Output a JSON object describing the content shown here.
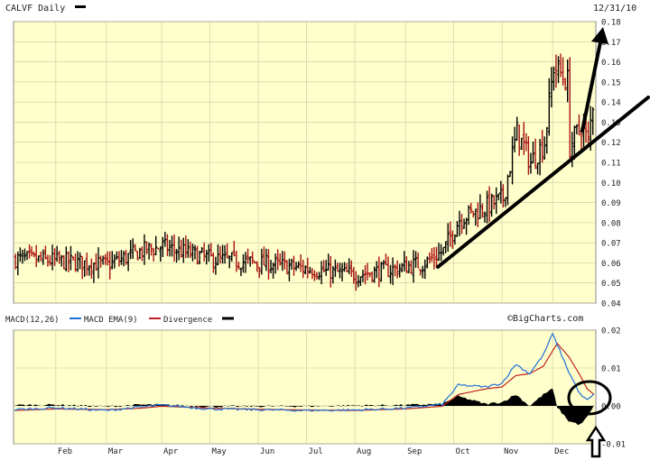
{
  "header": {
    "symbol_label": "CALVF Daily",
    "date_label": "12/31/10",
    "watermark": "©BigCharts.com"
  },
  "colors": {
    "plot_bg": "#ffffcc",
    "grid": "#c8c8a0",
    "up_bar": "#000000",
    "down_bar": "#aa1111",
    "macd_line": "#1f6fd8",
    "ema_line": "#c02020",
    "divergence": "#000000",
    "annotation": "#000000"
  },
  "chart_data": [
    {
      "type": "ohlc",
      "title": "CALVF Daily",
      "y_axis_side": "right",
      "ylim": [
        0.04,
        0.18
      ],
      "yticks": [
        "0.04",
        "0.05",
        "0.06",
        "0.07",
        "0.08",
        "0.09",
        "0.10",
        "0.11",
        "0.12",
        "0.13",
        "0.14",
        "0.15",
        "0.16",
        "0.17",
        "0.18"
      ],
      "months": [
        "Feb",
        "Mar",
        "Apr",
        "May",
        "Jun",
        "Jul",
        "Aug",
        "Sep",
        "Oct",
        "Nov",
        "Dec"
      ],
      "month_start_day": [
        18,
        40,
        64,
        85,
        106,
        127,
        148,
        170,
        191,
        212,
        234
      ],
      "total_days": 252,
      "price_anchors": [
        {
          "day": 0,
          "price": 0.062
        },
        {
          "day": 18,
          "price": 0.061
        },
        {
          "day": 40,
          "price": 0.059
        },
        {
          "day": 55,
          "price": 0.066
        },
        {
          "day": 64,
          "price": 0.068
        },
        {
          "day": 85,
          "price": 0.062
        },
        {
          "day": 106,
          "price": 0.06
        },
        {
          "day": 127,
          "price": 0.057
        },
        {
          "day": 148,
          "price": 0.054
        },
        {
          "day": 165,
          "price": 0.057
        },
        {
          "day": 178,
          "price": 0.06
        },
        {
          "day": 186,
          "price": 0.066
        },
        {
          "day": 193,
          "price": 0.082
        },
        {
          "day": 205,
          "price": 0.088
        },
        {
          "day": 212,
          "price": 0.092
        },
        {
          "day": 218,
          "price": 0.125
        },
        {
          "day": 224,
          "price": 0.11
        },
        {
          "day": 230,
          "price": 0.12
        },
        {
          "day": 234,
          "price": 0.158
        },
        {
          "day": 240,
          "price": 0.15
        },
        {
          "day": 241,
          "price": 0.118
        },
        {
          "day": 246,
          "price": 0.128
        },
        {
          "day": 249,
          "price": 0.12
        },
        {
          "day": 252,
          "price": 0.15
        }
      ]
    },
    {
      "type": "line",
      "title": "MACD(12,26)",
      "ylim": [
        -0.01,
        0.02
      ],
      "yticks": [
        "0.02",
        "0.01",
        "0.00",
        "-0.01"
      ],
      "series": [
        {
          "name": "MACD",
          "color": "#1f6fd8",
          "anchors": [
            {
              "day": 0,
              "value": -0.001
            },
            {
              "day": 18,
              "value": -0.0005
            },
            {
              "day": 40,
              "value": -0.0012
            },
            {
              "day": 55,
              "value": -0.0003
            },
            {
              "day": 64,
              "value": 0.0002
            },
            {
              "day": 85,
              "value": -0.0008
            },
            {
              "day": 106,
              "value": -0.001
            },
            {
              "day": 127,
              "value": -0.0012
            },
            {
              "day": 148,
              "value": -0.0011
            },
            {
              "day": 170,
              "value": -0.0006
            },
            {
              "day": 186,
              "value": 0.0004
            },
            {
              "day": 193,
              "value": 0.0055
            },
            {
              "day": 205,
              "value": 0.005
            },
            {
              "day": 212,
              "value": 0.006
            },
            {
              "day": 218,
              "value": 0.011
            },
            {
              "day": 224,
              "value": 0.0085
            },
            {
              "day": 230,
              "value": 0.0135
            },
            {
              "day": 234,
              "value": 0.019
            },
            {
              "day": 241,
              "value": 0.009
            },
            {
              "day": 246,
              "value": 0.003
            },
            {
              "day": 249,
              "value": 0.0015
            },
            {
              "day": 252,
              "value": 0.003
            }
          ]
        },
        {
          "name": "MACD EMA(9)",
          "color": "#c02020",
          "anchors": [
            {
              "day": 0,
              "value": -0.0012
            },
            {
              "day": 18,
              "value": -0.0008
            },
            {
              "day": 40,
              "value": -0.001
            },
            {
              "day": 55,
              "value": -0.0006
            },
            {
              "day": 64,
              "value": -0.0001
            },
            {
              "day": 85,
              "value": -0.0006
            },
            {
              "day": 106,
              "value": -0.0009
            },
            {
              "day": 127,
              "value": -0.0011
            },
            {
              "day": 148,
              "value": -0.0012
            },
            {
              "day": 170,
              "value": -0.0008
            },
            {
              "day": 186,
              "value": -0.0001
            },
            {
              "day": 193,
              "value": 0.003
            },
            {
              "day": 205,
              "value": 0.0045
            },
            {
              "day": 212,
              "value": 0.005
            },
            {
              "day": 218,
              "value": 0.008
            },
            {
              "day": 224,
              "value": 0.0085
            },
            {
              "day": 230,
              "value": 0.0105
            },
            {
              "day": 236,
              "value": 0.0165
            },
            {
              "day": 241,
              "value": 0.013
            },
            {
              "day": 246,
              "value": 0.008
            },
            {
              "day": 249,
              "value": 0.0045
            },
            {
              "day": 252,
              "value": 0.003
            }
          ]
        },
        {
          "name": "Divergence",
          "color": "#000000",
          "type": "area"
        }
      ]
    }
  ]
}
